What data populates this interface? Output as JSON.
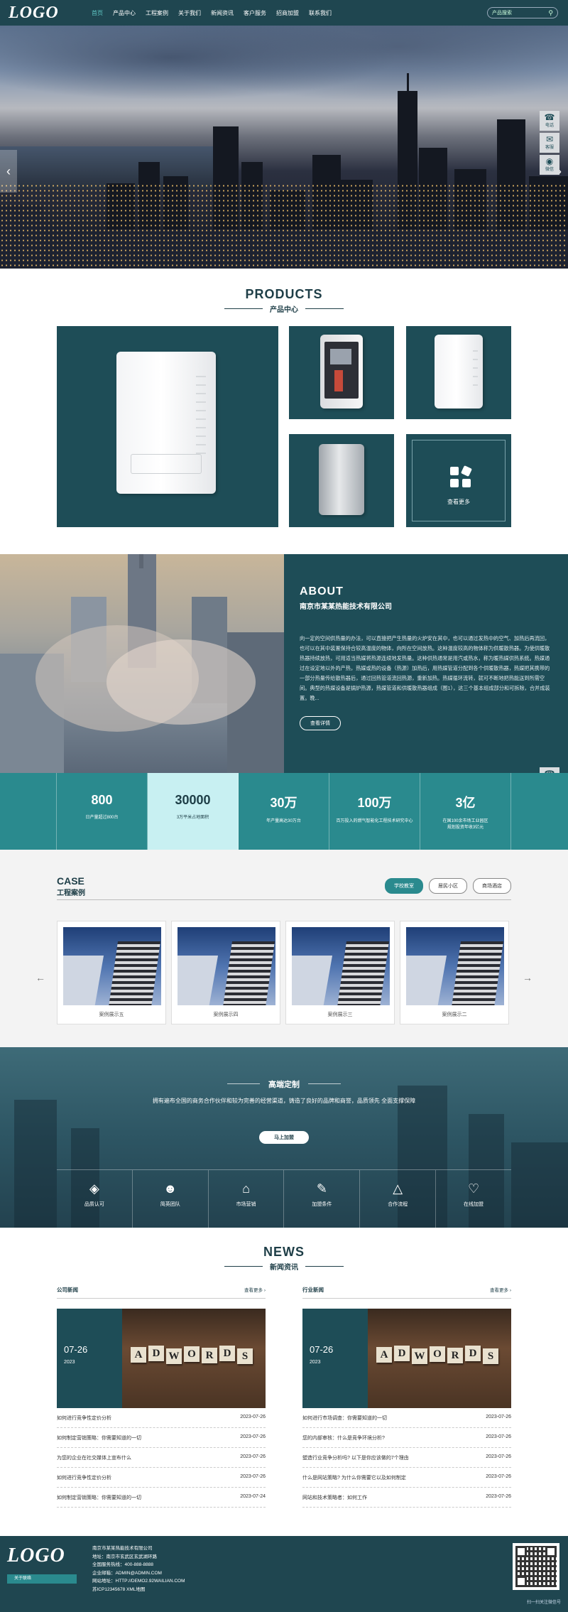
{
  "header": {
    "logo": "LOGO",
    "nav": [
      "首页",
      "产品中心",
      "工程案例",
      "关于我们",
      "新闻资讯",
      "客户服务",
      "招商加盟",
      "联系我们"
    ],
    "search_placeholder": "产品搜索"
  },
  "hero": {
    "tools": [
      {
        "icon": "phone-icon",
        "label": "电话"
      },
      {
        "icon": "chat-icon",
        "label": "客服"
      },
      {
        "icon": "wechat-icon",
        "label": "微信"
      }
    ]
  },
  "products": {
    "title": "PRODUCTS",
    "subtitle": "产品中心",
    "more_label": "查看更多"
  },
  "about": {
    "title": "ABOUT",
    "company": "南京市某某热能技术有限公司",
    "text": "向一定的空间供热量的办法，可以直接把产生热量的火炉安在其中，也可以通过发热中的空气、加热后再流回，也可以在其中装置保持合较高温度的物体，向所在空间放热。这种温度较高的物体称为供暖散热器。为使供暖散热器持续放热，可用适当热媒将热源连续地发热量。这种供热通常是用汽或热水，称为暖热媒供热系统。热媒通过在设定地以外的产热，热媒或热的设备（热源）加热后，用热媒管道分配到各个供暖散热器，热媒把其携带的一部分热量传给散热器后，通过回热管道流回热源，重新加热。热媒循环流转，就可不断地把热能送到所需空间。典型的热媒设备是锅炉热源，热媒管道和供暖散热器组成（图1），这三个基本组成部分和可拆除，合并成装置。晚...",
    "button": "查看详情"
  },
  "stats": [
    {
      "value": "800",
      "desc": "日产量超过800台"
    },
    {
      "value": "30000",
      "desc": "3万平米占地面积"
    },
    {
      "value": "30万",
      "desc": "年产量高达30万台"
    },
    {
      "value": "100万",
      "desc": "百万投入的燃气智能化工程技术研究中心"
    },
    {
      "value": "3亿",
      "desc": "在国100余市场工业园区\n规划投资年收3亿元"
    }
  ],
  "case": {
    "title": "CASE",
    "subtitle": "工程案例",
    "tabs": [
      "学校教室",
      "居民小区",
      "商场酒店"
    ],
    "items": [
      "案例展示五",
      "案例展示四",
      "案例展示三",
      "案例展示二"
    ]
  },
  "custom": {
    "title": "高端定制",
    "desc": "拥有遍布全国的商务合作伙伴和较为完善的经营渠道，铸造了良好的品牌和商誉，品质领先 全面支撑保障",
    "button": "马上加盟",
    "features": [
      {
        "icon": "diamond-icon",
        "label": "品质认可"
      },
      {
        "icon": "team-icon",
        "label": "简英团队"
      },
      {
        "icon": "bank-icon",
        "label": "市场营销"
      },
      {
        "icon": "document-icon",
        "label": "加盟条件"
      },
      {
        "icon": "network-icon",
        "label": "合作流程"
      },
      {
        "icon": "handshake-icon",
        "label": "在线加盟"
      }
    ]
  },
  "news": {
    "title": "NEWS",
    "subtitle": "新闻资讯",
    "more": "查看更多",
    "columns": [
      {
        "name": "公司新闻",
        "feature": {
          "date": "07-26",
          "year": "2023"
        },
        "items": [
          {
            "title": "如何进行竞争性定价分析",
            "date": "2023-07-26"
          },
          {
            "title": "如何制定营销策略：你需要知道的一切",
            "date": "2023-07-26"
          },
          {
            "title": "为您的企业在社交媒体上宣布什么",
            "date": "2023-07-26"
          },
          {
            "title": "如何进行竞争性定价分析",
            "date": "2023-07-26"
          },
          {
            "title": "如何制定营销策略：你需要知道的一切",
            "date": "2023-07-24"
          }
        ]
      },
      {
        "name": "行业新闻",
        "feature": {
          "date": "07-26",
          "year": "2023"
        },
        "items": [
          {
            "title": "如何进行市场调查：你需要知道的一切",
            "date": "2023-07-26"
          },
          {
            "title": "您的内部审核：什么是竞争环境分析?",
            "date": "2023-07-26"
          },
          {
            "title": "塑造行业竞争分析吗? 以下是你应该做的7个理由",
            "date": "2023-07-26"
          },
          {
            "title": "什么是网站策略? 为什么你需要它以及如何制定",
            "date": "2023-07-26"
          },
          {
            "title": "网站和技术策略者：如何工作",
            "date": "2023-07-26"
          }
        ]
      }
    ],
    "tile_letters": [
      "A",
      "D",
      "W",
      "O",
      "R",
      "D",
      "S"
    ]
  },
  "footer": {
    "logo": "LOGO",
    "button": "关于联络",
    "lines": [
      "南京市某某热能技术有限公司",
      "地址：南京市玄武区玄武湖环路",
      "全国服务热线：400-888-8888",
      "企业邮箱：ADMIN@ADMIN.COM",
      "网站地址：HTTP://DEMO2.92WAILIAN.COM",
      "苏ICP12345678  XML地图"
    ],
    "qr_caption": "扫一扫关注微信号"
  }
}
